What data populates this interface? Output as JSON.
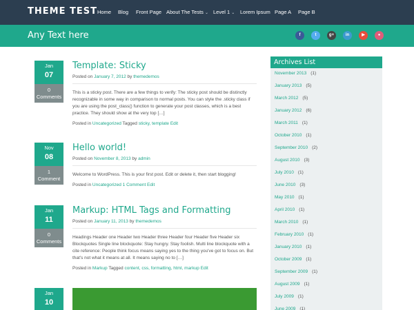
{
  "site": {
    "title": "THEME TEST",
    "tagline": "Any Text here"
  },
  "nav": [
    {
      "label": "Home",
      "caret": ""
    },
    {
      "label": "Blog",
      "caret": ""
    },
    {
      "label": "Front Page",
      "caret": ""
    },
    {
      "label": "About The Tests",
      "caret": "⌄"
    },
    {
      "label": "Level 1",
      "caret": "⌄"
    },
    {
      "label": "Lorem Ipsum",
      "caret": ""
    },
    {
      "label": "Page A",
      "caret": ""
    },
    {
      "label": "Page B",
      "caret": ""
    }
  ],
  "social": [
    {
      "icon": "facebook-icon",
      "glyph": "f",
      "color": "#3b5998"
    },
    {
      "icon": "twitter-icon",
      "glyph": "t",
      "color": "#55acee"
    },
    {
      "icon": "google-plus-icon",
      "glyph": "g+",
      "color": "#444444"
    },
    {
      "icon": "linkedin-icon",
      "glyph": "in",
      "color": "#3d9ad1"
    },
    {
      "icon": "youtube-icon",
      "glyph": "▶",
      "color": "#e74c3c"
    },
    {
      "icon": "dribbble-icon",
      "glyph": "●",
      "color": "#e05c7a"
    }
  ],
  "posts": [
    {
      "month": "Jan",
      "day": "07",
      "comments": "0",
      "comments_label": "Comments",
      "title": "Template: Sticky",
      "meta_prefix": "Posted on",
      "date": "January 7, 2012",
      "meta_by": "by",
      "author": "themedemos",
      "body": "This is a sticky post. There are a few things to verify: The sticky post should be distinctly recognizable in some way in comparison to normal posts. You can style the .sticky class if you are using the post_class() function to generate your post classes, which is a best practice. They should show at the very top […]",
      "footer_prefix": "Posted in",
      "category": "Uncategorized",
      "tagged_label": "Tagged",
      "tags": "sticky, template",
      "extra": "Edit"
    },
    {
      "month": "Nov",
      "day": "08",
      "comments": "1",
      "comments_label": "Comment",
      "title": "Hello world!",
      "meta_prefix": "Posted on",
      "date": "November 8, 2013",
      "meta_by": "by",
      "author": "admin",
      "body": "Welcome to WordPress. This is your first post. Edit or delete it, then start blogging!",
      "footer_prefix": "Posted in",
      "category": "Uncategorized",
      "tagged_label": "",
      "tags": "",
      "extra": "1 Comment Edit"
    },
    {
      "month": "Jan",
      "day": "11",
      "comments": "0",
      "comments_label": "Comments",
      "title": "Markup: HTML Tags and Formatting",
      "meta_prefix": "Posted on",
      "date": "January 11, 2013",
      "meta_by": "by",
      "author": "themedemos",
      "body": "Headings Header one Header two Header three Header four Header five Header six Blockquotes Single line blockquote: Stay hungry. Stay foolish. Multi line blockquote with a cite reference: People think focus means saying yes to the thing you've got to focus on. But that's not what it means at all. It means saying no to […]",
      "footer_prefix": "Posted in",
      "category": "Markup",
      "tagged_label": "Tagged",
      "tags": "content, css, formatting, html, markup",
      "extra": "Edit"
    },
    {
      "month": "Jan",
      "day": "10"
    }
  ],
  "sidebar": {
    "title": "Archives List",
    "items": [
      {
        "label": "November 2013",
        "count": "(1)"
      },
      {
        "label": "January 2013",
        "count": "(5)"
      },
      {
        "label": "March 2012",
        "count": "(5)"
      },
      {
        "label": "January 2012",
        "count": "(6)"
      },
      {
        "label": "March 2011",
        "count": "(1)"
      },
      {
        "label": "October 2010",
        "count": "(1)"
      },
      {
        "label": "September 2010",
        "count": "(2)"
      },
      {
        "label": "August 2010",
        "count": "(3)"
      },
      {
        "label": "July 2010",
        "count": "(1)"
      },
      {
        "label": "June 2010",
        "count": "(3)"
      },
      {
        "label": "May 2010",
        "count": "(1)"
      },
      {
        "label": "April 2010",
        "count": "(1)"
      },
      {
        "label": "March 2010",
        "count": "(1)"
      },
      {
        "label": "February 2010",
        "count": "(1)"
      },
      {
        "label": "January 2010",
        "count": "(1)"
      },
      {
        "label": "October 2009",
        "count": "(1)"
      },
      {
        "label": "September 2009",
        "count": "(1)"
      },
      {
        "label": "August 2009",
        "count": "(1)"
      },
      {
        "label": "July 2009",
        "count": "(1)"
      },
      {
        "label": "June 2009",
        "count": "(1)"
      }
    ]
  },
  "colors": {
    "nav_bg": "#2c3e50",
    "accent": "#1fa88c",
    "comment_box": "#7f8c8d",
    "sidebar_bg": "#ecf0f1",
    "image_green": "#3a9a32"
  }
}
